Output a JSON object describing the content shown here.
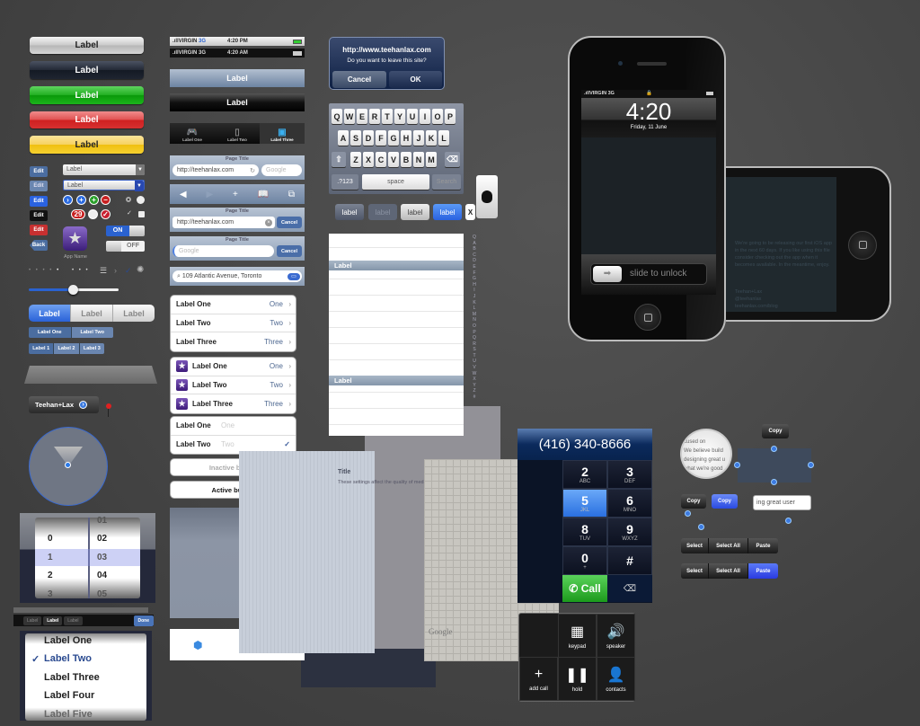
{
  "buttons": {
    "silver": "Label",
    "black": "Label",
    "green": "Label",
    "red": "Label",
    "yellow": "Label"
  },
  "edit_buttons": [
    "Edit",
    "Edit",
    "Edit",
    "Edit",
    "Edit"
  ],
  "back_button": "Back",
  "selects": [
    "Label",
    "Label"
  ],
  "badge_count": "29",
  "app_icon": {
    "label": "App Name"
  },
  "toggles": {
    "on": "ON",
    "off": "OFF"
  },
  "segmented": [
    "Label",
    "Label",
    "Label"
  ],
  "segmented_small_2": [
    "Label One",
    "Label Two"
  ],
  "segmented_small_3": [
    "Label 1",
    "Label 2",
    "Label 3"
  ],
  "map_callout": "Teehan+Lax",
  "picker": {
    "left": [
      "0",
      "1",
      "2",
      "3"
    ],
    "right": [
      "01",
      "02",
      "03",
      "04",
      "05"
    ]
  },
  "picker_toolbar": {
    "tabs": [
      "Label",
      "Label",
      "Label"
    ],
    "done": "Done"
  },
  "list_picker": {
    "items": [
      "Label One",
      "Label Two",
      "Label Three",
      "Label Four",
      "Label Five"
    ],
    "checked": "✓"
  },
  "status_light": {
    "carrier": "VIRGIN",
    "network": "3G",
    "time": "4:20 PM"
  },
  "status_dark": {
    "carrier": "VIRGIN",
    "network": "3G",
    "time": "4:20 AM"
  },
  "navbars": [
    "Label",
    "Label"
  ],
  "tabbar": [
    "Label One",
    "Label Two",
    "Label Three"
  ],
  "browser1": {
    "title": "Page Title",
    "url": "http://teehanlax.com",
    "search_placeholder": "Google"
  },
  "browser2": {
    "title": "Page Title",
    "url": "http://teehanlax.com",
    "cancel": "Cancel"
  },
  "browser3": {
    "title": "Page Title",
    "placeholder": "Google",
    "cancel": "Cancel"
  },
  "maps_search": "109 Atlantic Avenue, Toronto",
  "table1": [
    {
      "label": "Label One",
      "value": "One"
    },
    {
      "label": "Label Two",
      "value": "Two"
    },
    {
      "label": "Label Three",
      "value": "Three"
    }
  ],
  "table2": [
    {
      "label": "Label One",
      "value": "One"
    },
    {
      "label": "Label Two",
      "value": "Two"
    },
    {
      "label": "Label Three",
      "value": "Three"
    }
  ],
  "table3": [
    {
      "label": "Label One",
      "value": "One"
    },
    {
      "label": "Label Two",
      "value": "Two",
      "checked": "✓"
    }
  ],
  "inactive_button": "Inactive button",
  "active_button": "Active button",
  "alert": {
    "title": "http://www.teehanlax.com",
    "message": "Do you want to leave this site?",
    "cancel": "Cancel",
    "ok": "OK"
  },
  "keyboard": {
    "row1": [
      "Q",
      "W",
      "E",
      "R",
      "T",
      "Y",
      "U",
      "I",
      "O",
      "P"
    ],
    "row2": [
      "A",
      "S",
      "D",
      "F",
      "G",
      "H",
      "J",
      "K",
      "L"
    ],
    "row3": [
      "Z",
      "X",
      "C",
      "V",
      "B",
      "N",
      "M"
    ],
    "numbers": ".?123",
    "space": "space",
    "search": "Search"
  },
  "key_labels": [
    "label",
    "label",
    "label",
    "label",
    "X"
  ],
  "plain_table": {
    "headers": [
      "Label",
      "Label"
    ],
    "index": [
      "Q",
      "A",
      "B",
      "C",
      "D",
      "E",
      "F",
      "G",
      "H",
      "I",
      "J",
      "K",
      "L",
      "M",
      "N",
      "O",
      "P",
      "Q",
      "R",
      "S",
      "T",
      "U",
      "V",
      "W",
      "X",
      "Y",
      "Z",
      "#"
    ]
  },
  "settings_panel": {
    "title": "Title",
    "text": "These settings affect the quality of media"
  },
  "maps_brand": "Google",
  "dialer": {
    "number": "(416) 340-8666",
    "keys": [
      {
        "d": "2",
        "l": "ABC"
      },
      {
        "d": "3",
        "l": "DEF"
      },
      {
        "d": "5",
        "l": "JKL"
      },
      {
        "d": "6",
        "l": "MNO"
      },
      {
        "d": "8",
        "l": "TUV"
      },
      {
        "d": "9",
        "l": "WXYZ"
      },
      {
        "d": "0",
        "l": "+"
      },
      {
        "d": "#",
        "l": ""
      }
    ],
    "call": "Call"
  },
  "incall": [
    {
      "icon": "▦",
      "label": "keypad"
    },
    {
      "icon": "🔊",
      "label": "speaker"
    },
    {
      "icon": "+",
      "label": "add call"
    },
    {
      "icon": "❚❚",
      "label": "hold"
    },
    {
      "icon": "👤",
      "label": "contacts"
    }
  ],
  "magnifier": [
    "cused on",
    "We believe build",
    "designing great u",
    "what we're good"
  ],
  "copy_labels": [
    "Copy",
    "Copy",
    "Copy"
  ],
  "text_selection": "ing great user",
  "edit_menu": [
    [
      "Select",
      "Select All",
      "Paste"
    ],
    [
      "Select",
      "Select All",
      "Paste"
    ]
  ],
  "phone": {
    "carrier": "VIRGIN",
    "network": "3G",
    "time": "4:20",
    "date": "Friday, 11 June",
    "unlock": "slide to unlock"
  },
  "landscape_text": [
    "We're going to be releasing our first iOS app in the next 60 days. If you like using this file consider checking out the app when it becomes available. In the meantime, enjoy.",
    "Teehan+Lax",
    "@teehanlax",
    "teehanlax.com/blog"
  ],
  "colors": {
    "background": "#454545",
    "ios_blue": "#2f6fe0",
    "nav_blue": "#6d84a2",
    "call_green": "#22a822",
    "dial_navy": "#0b2a5c"
  }
}
